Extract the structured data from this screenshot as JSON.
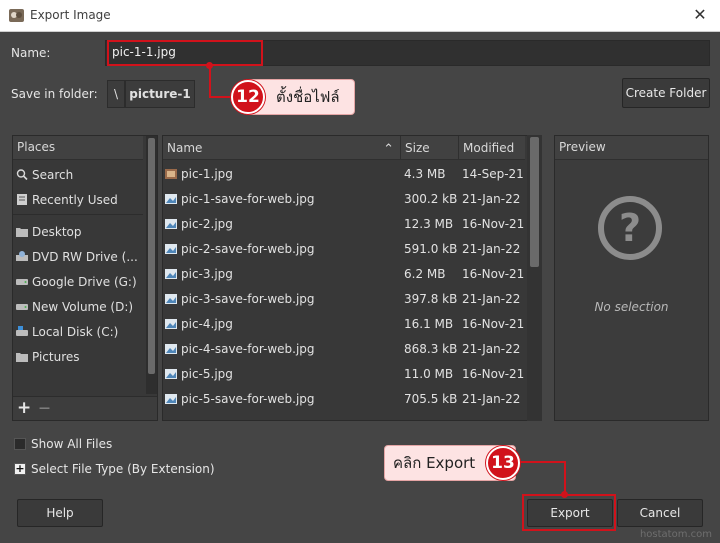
{
  "window": {
    "title": "Export Image",
    "close_glyph": "✕"
  },
  "name_field": {
    "label": "Name:",
    "value": "pic-1-1.jpg"
  },
  "save_in": {
    "label": "Save in folder:",
    "root_glyph": "\\",
    "folder": "picture-1"
  },
  "create_folder_label": "Create Folder",
  "places": {
    "header": "Places",
    "items": [
      {
        "label": "Search",
        "icon": "search-icon"
      },
      {
        "label": "Recently Used",
        "icon": "recent-icon"
      },
      {
        "label": "Desktop",
        "icon": "folder-icon"
      },
      {
        "label": "DVD RW Drive (...",
        "icon": "optical-drive-icon"
      },
      {
        "label": "Google Drive (G:)",
        "icon": "drive-icon"
      },
      {
        "label": "New Volume (D:)",
        "icon": "drive-icon"
      },
      {
        "label": "Local Disk (C:)",
        "icon": "system-drive-icon"
      },
      {
        "label": "Pictures",
        "icon": "folder-icon"
      }
    ],
    "add_glyph": "+",
    "remove_glyph": "—"
  },
  "files": {
    "columns": {
      "name": "Name",
      "size": "Size",
      "modified": "Modified"
    },
    "sort_glyph": "⌃",
    "rows": [
      {
        "name": "pic-1.jpg",
        "size": "4.3 MB",
        "modified": "14-Sep-21"
      },
      {
        "name": "pic-1-save-for-web.jpg",
        "size": "300.2 kB",
        "modified": "21-Jan-22"
      },
      {
        "name": "pic-2.jpg",
        "size": "12.3 MB",
        "modified": "16-Nov-21"
      },
      {
        "name": "pic-2-save-for-web.jpg",
        "size": "591.0 kB",
        "modified": "21-Jan-22"
      },
      {
        "name": "pic-3.jpg",
        "size": "6.2 MB",
        "modified": "16-Nov-21"
      },
      {
        "name": "pic-3-save-for-web.jpg",
        "size": "397.8 kB",
        "modified": "21-Jan-22"
      },
      {
        "name": "pic-4.jpg",
        "size": "16.1 MB",
        "modified": "16-Nov-21"
      },
      {
        "name": "pic-4-save-for-web.jpg",
        "size": "868.3 kB",
        "modified": "21-Jan-22"
      },
      {
        "name": "pic-5.jpg",
        "size": "11.0 MB",
        "modified": "16-Nov-21"
      },
      {
        "name": "pic-5-save-for-web.jpg",
        "size": "705.5 kB",
        "modified": "21-Jan-22"
      }
    ]
  },
  "preview": {
    "header": "Preview",
    "empty_text": "No selection",
    "glyph": "?"
  },
  "options": {
    "show_all_files": "Show All Files",
    "select_file_type": "Select File Type (By Extension)",
    "expander_glyph": "+"
  },
  "buttons": {
    "help": "Help",
    "export": "Export",
    "cancel": "Cancel"
  },
  "callouts": {
    "step12": {
      "number": "12",
      "text": "ตั้งชื่อไฟล์"
    },
    "step13": {
      "number": "13",
      "text": "คลิก Export"
    }
  },
  "watermark": "hostatom.com",
  "colors": {
    "accent_red": "#d1121b",
    "callout_bg": "#fde3e3",
    "dialog_bg": "#454545"
  }
}
